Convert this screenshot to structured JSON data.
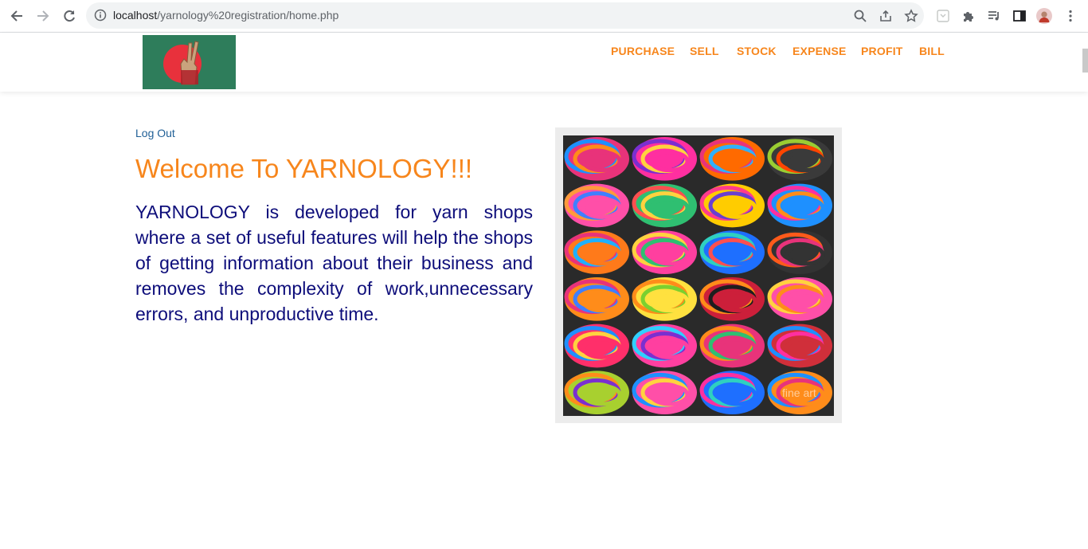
{
  "browser": {
    "url_host": "localhost",
    "url_path": "/yarnology%20registration/home.php"
  },
  "site": {
    "logo_alt": "victory hand flag logo",
    "menu": [
      {
        "label": "PURCHASE"
      },
      {
        "label": "SELL"
      },
      {
        "label": "STOCK"
      },
      {
        "label": "EXPENSE"
      },
      {
        "label": "PROFIT"
      },
      {
        "label": "BILL"
      }
    ]
  },
  "main": {
    "logout_label": "Log Out",
    "welcome_title": "Welcome To YARNOLOGY!!!",
    "description": "YARNOLOGY is developed for yarn shops where a set of useful features will help the shops of getting information about their business and removes the complexity of work,unnecessary errors, and unproductive time.",
    "image_watermark": "fine art"
  },
  "colors": {
    "accent_orange": "#f7861c",
    "text_navy": "#0d0d7a",
    "link_blue": "#1f5f96",
    "logo_green": "#2e7d5b",
    "logo_red": "#e8313c"
  }
}
